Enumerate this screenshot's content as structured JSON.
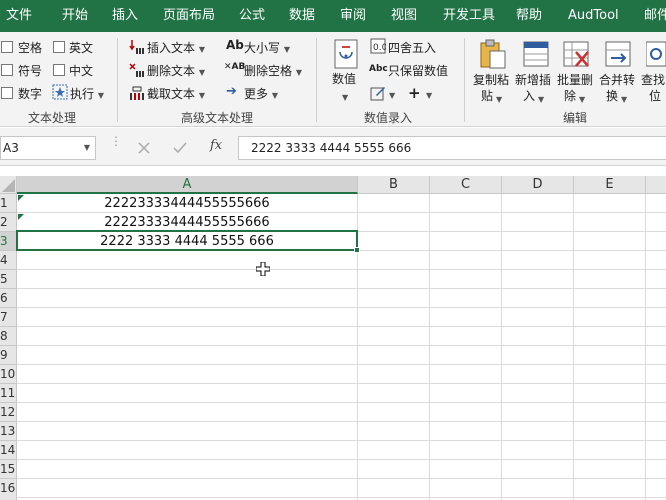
{
  "menu": [
    "文件",
    "开始",
    "插入",
    "页面布局",
    "公式",
    "数据",
    "审阅",
    "视图",
    "开发工具",
    "帮助",
    "AudTool",
    "邮件"
  ],
  "ribbon": {
    "group1": {
      "items": [
        "空格",
        "英文",
        "符号",
        "中文",
        "数字",
        "执行"
      ],
      "label": "文本处理"
    },
    "group2": {
      "items": [
        "插入文本",
        "删除文本",
        "截取文本",
        "大小写",
        "删除空格",
        "更多"
      ],
      "label": "高级文本处理"
    },
    "group3": {
      "big": "数值",
      "items": [
        "四舍五入",
        "只保留数值"
      ],
      "label": "数值录入"
    },
    "group4": {
      "buttons": [
        {
          "l1": "复制粘",
          "l2": "贴"
        },
        {
          "l1": "新增插",
          "l2": "入"
        },
        {
          "l1": "批量删",
          "l2": "除"
        },
        {
          "l1": "合并转",
          "l2": "换"
        },
        {
          "l1": "查找",
          "l2": "位"
        }
      ],
      "label": "编辑"
    }
  },
  "formula_bar": {
    "cell_ref": "A3",
    "fx": "fx",
    "value": "2222 3333 4444 5555 666"
  },
  "grid": {
    "columns": [
      "A",
      "B",
      "C",
      "D",
      "E"
    ],
    "rows": [
      "1",
      "2",
      "3",
      "4",
      "5",
      "6",
      "7",
      "8",
      "9",
      "10",
      "11",
      "12",
      "13",
      "14",
      "15",
      "16"
    ],
    "cells": {
      "A1": "22223333444455555666",
      "A2": "22223333444455555666",
      "A3": "2222 3333 4444 5555 666"
    },
    "selected_cell": "A3"
  },
  "colors": {
    "menubar": "#217346",
    "selection": "#217346",
    "ribbon_bg": "#f3f3f3"
  }
}
